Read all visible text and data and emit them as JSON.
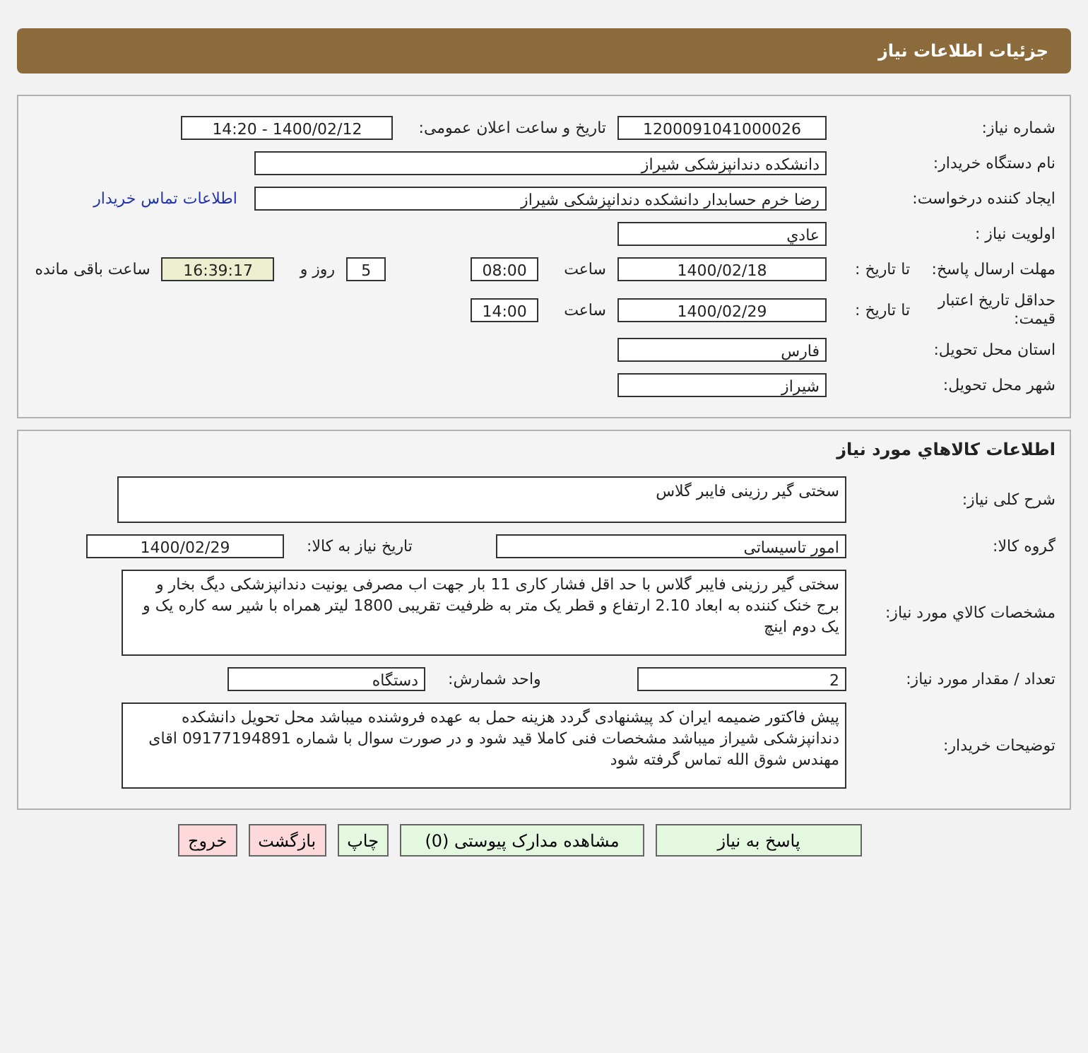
{
  "header": {
    "title": "جزئیات اطلاعات نیاز"
  },
  "request": {
    "need_number": {
      "label": "شماره نیاز:",
      "value": "1200091041000026"
    },
    "announce_datetime": {
      "label": "تاریخ و ساعت اعلان عمومی:",
      "value": "1400/02/12 - 14:20"
    },
    "buyer_org": {
      "label": "نام دستگاه خریدار:",
      "value": "دانشکده دندانپزشکی شیراز"
    },
    "requester": {
      "label": "ایجاد کننده درخواست:",
      "value": "رضا خرم حسابدار دانشکده دندانپزشکی شیراز"
    },
    "buyer_contact_link": "اطلاعات تماس خریدار",
    "priority": {
      "label": "اولویت نیاز :",
      "value": "عادي"
    },
    "response_deadline": {
      "label": "مهلت ارسال پاسخ:",
      "to_date_label": "تا تاریخ :",
      "date": "1400/02/18",
      "time_label": "ساعت",
      "time": "08:00",
      "days": "5",
      "days_label": "روز و",
      "remaining": "16:39:17",
      "remaining_label": "ساعت باقی مانده"
    },
    "price_validity": {
      "label": "حداقل تاریخ اعتبار قیمت:",
      "to_date_label": "تا تاریخ :",
      "date": "1400/02/29",
      "time_label": "ساعت",
      "time": "14:00"
    },
    "province": {
      "label": "استان محل تحویل:",
      "value": "فارس"
    },
    "city": {
      "label": "شهر محل تحویل:",
      "value": "شیراز"
    }
  },
  "goods": {
    "title": "اطلاعات کالاهاي مورد نياز",
    "summary": {
      "label": "شرح کلی نیاز:",
      "value": "سختی گیر رزینی فایبر گلاس"
    },
    "group": {
      "label": "گروه کالا:",
      "value": "امور تاسیساتی"
    },
    "need_date": {
      "label": "تاریخ نیاز به کالا:",
      "value": "1400/02/29"
    },
    "specs": {
      "label": "مشخصات کالاي مورد نياز:",
      "value": "سختی گیر رزینی فایبر گلاس با حد اقل فشار کاری 11 بار جهت اب مصرفی یونیت دندانپزشکی دیگ بخار و برج خنک کننده به ابعاد 2.10 ارتفاع و قطر یک متر به ظرفیت تقریبی 1800 لیتر همراه با شیر سه کاره یک و یک دوم اینچ"
    },
    "quantity": {
      "label": "تعداد / مقدار مورد نیاز:",
      "value": "2"
    },
    "unit": {
      "label": "واحد شمارش:",
      "value": "دستگاه"
    },
    "buyer_notes": {
      "label": "توضیحات خریدار:",
      "value": "پیش فاکتور ضمیمه ایران کد پیشنهادی گردد هزینه حمل به عهده فروشنده میباشد محل تحویل دانشکده دندانپزشکی شیراز میباشد مشخصات فنی کاملا قید شود و در صورت سوال با شماره 09177194891 اقای مهندس شوق الله تماس گرفته شود"
    }
  },
  "buttons": [
    {
      "label": "پاسخ به نیاز",
      "kind": "primary"
    },
    {
      "label": "مشاهده مدارک پیوستی (0)",
      "kind": "primary"
    },
    {
      "label": "چاپ",
      "kind": "plain"
    },
    {
      "label": "بازگشت",
      "kind": "danger"
    },
    {
      "label": "خروج",
      "kind": "danger"
    }
  ]
}
